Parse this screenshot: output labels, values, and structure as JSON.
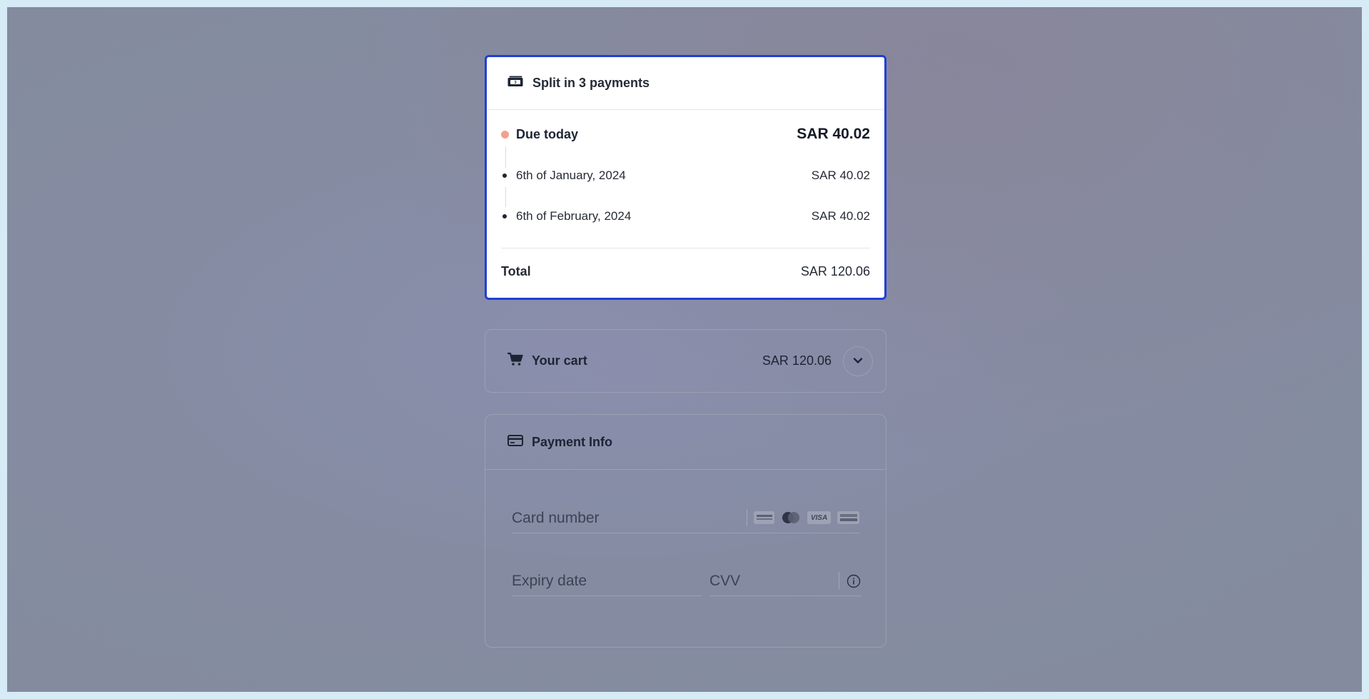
{
  "split": {
    "title": "Split in 3 payments",
    "due_label": "Due today",
    "due_amount": "SAR 40.02",
    "installments": [
      {
        "date": "6th of January, 2024",
        "amount": "SAR 40.02"
      },
      {
        "date": "6th of February, 2024",
        "amount": "SAR 40.02"
      }
    ],
    "total_label": "Total",
    "total_amount": "SAR 120.06"
  },
  "cart": {
    "title": "Your cart",
    "amount": "SAR 120.06",
    "expand_icon": "chevron-down-icon"
  },
  "payment": {
    "title": "Payment Info",
    "card_number_placeholder": "Card number",
    "expiry_placeholder": "Expiry date",
    "cvv_placeholder": "CVV",
    "brands": [
      "mada",
      "mastercard",
      "VISA",
      "amex"
    ]
  },
  "colors": {
    "accent_border": "#1f3fd6",
    "due_dot": "#f2a08d",
    "overlay": "#858ca2"
  }
}
